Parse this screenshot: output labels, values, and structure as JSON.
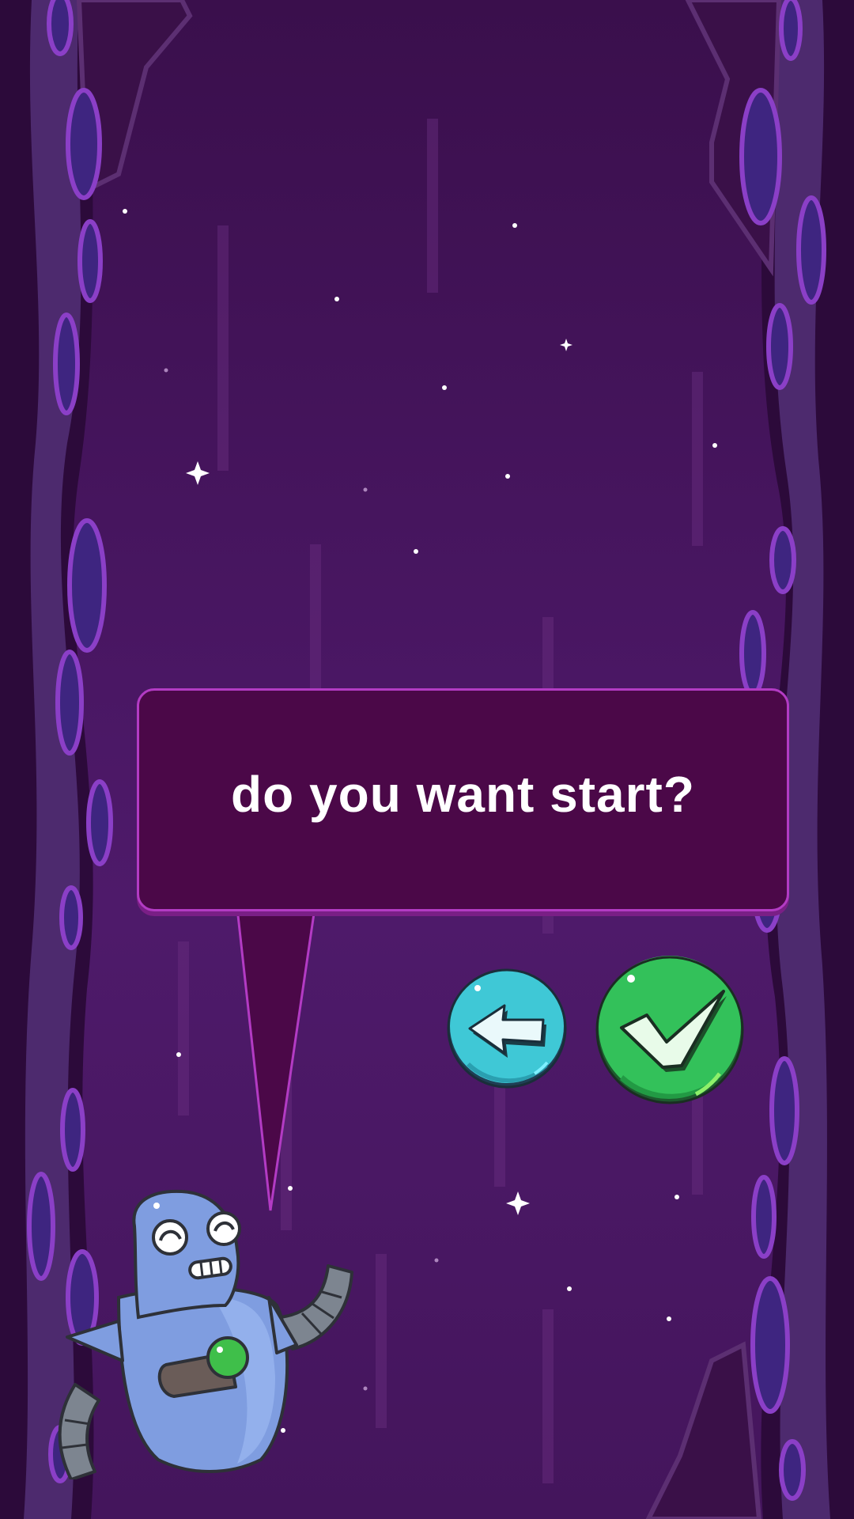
{
  "dialog": {
    "question": "do you want start?"
  },
  "buttons": {
    "back": {
      "icon": "arrow-left-icon",
      "color": "#3fc8d6"
    },
    "confirm": {
      "icon": "checkmark-icon",
      "color": "#33c15a"
    }
  },
  "character": {
    "name": "robot-character",
    "body_color": "#7f9de0",
    "accent_color": "#3fbf4a"
  },
  "theme": {
    "background": "#4a1764",
    "dialog_fill": "#4b0848",
    "dialog_border": "#b33bc4"
  }
}
